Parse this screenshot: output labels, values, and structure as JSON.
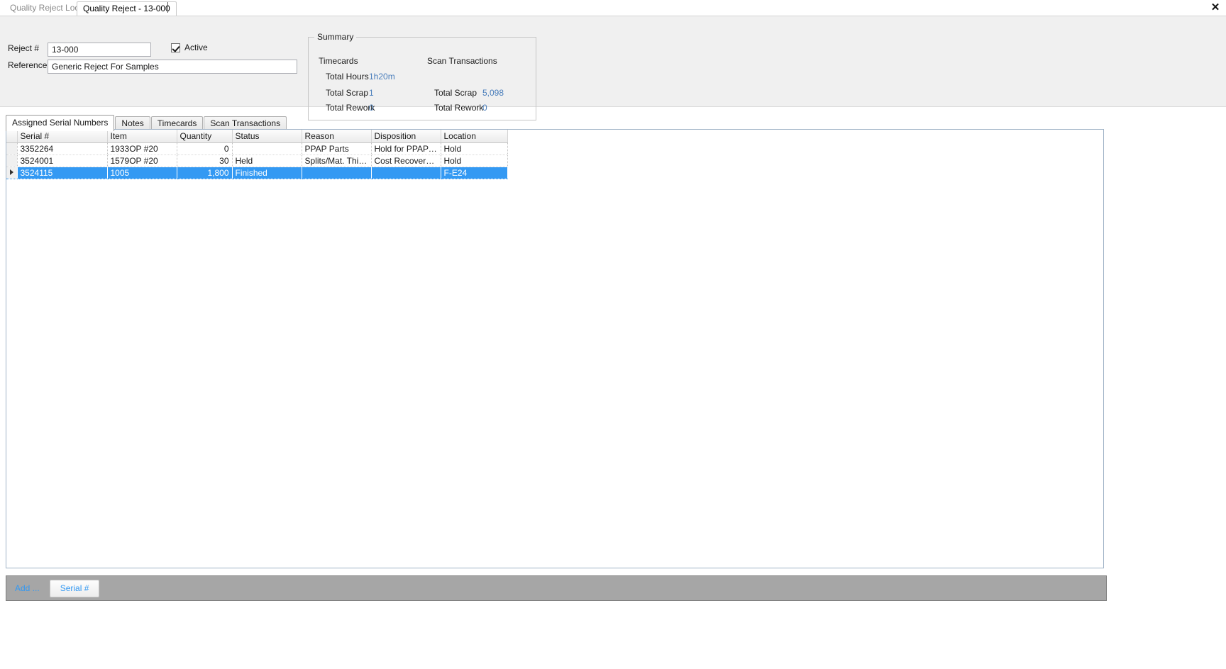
{
  "window": {
    "close_label": "✕"
  },
  "doc_tabs": [
    {
      "label": "Quality Reject Lookup",
      "active": false
    },
    {
      "label": "Quality Reject - 13-000",
      "active": true
    }
  ],
  "form": {
    "reject_label": "Reject #",
    "reject_value": "13-000",
    "reject_placeholder": "",
    "reference_label": "Reference",
    "reference_value": "Generic Reject For Samples",
    "reference_placeholder": "",
    "active_label": "Active",
    "active_checked": true
  },
  "summary": {
    "title": "Summary",
    "timecards_header": "Timecards",
    "scan_header": "Scan Transactions",
    "timecards": {
      "total_hours_label": "Total Hours",
      "total_hours_value": "1h20m",
      "total_scrap_label": "Total Scrap",
      "total_scrap_value": "1",
      "total_rework_label": "Total Rework",
      "total_rework_value": "0"
    },
    "scan": {
      "total_scrap_label": "Total Scrap",
      "total_scrap_value": "5,098",
      "total_rework_label": "Total Rework",
      "total_rework_value": "0"
    },
    "value_color": "#4a7ebb"
  },
  "inner_tabs": [
    {
      "label": "Assigned Serial Numbers",
      "selected": true
    },
    {
      "label": "Notes",
      "selected": false
    },
    {
      "label": "Timecards",
      "selected": false
    },
    {
      "label": "Scan Transactions",
      "selected": false
    }
  ],
  "grid": {
    "columns": [
      "Serial #",
      "Item",
      "Quantity",
      "Status",
      "Reason",
      "Disposition",
      "Location"
    ],
    "rows": [
      {
        "serial": "3352264",
        "item": "1933OP #20",
        "quantity": "0",
        "status": "",
        "reason": "PPAP Parts",
        "disposition": "Hold for PPAP A…",
        "location": "Hold",
        "selected": false,
        "current": false
      },
      {
        "serial": "3524001",
        "item": "1579OP #20",
        "quantity": "30",
        "status": "Held",
        "reason": "Splits/Mat. Thinn…",
        "disposition": "Cost Recovery -…",
        "location": "Hold",
        "selected": false,
        "current": false
      },
      {
        "serial": "3524115",
        "item": "1005",
        "quantity": "1,800",
        "status": "Finished",
        "reason": "",
        "disposition": "",
        "location": "F-E24",
        "selected": true,
        "current": true
      }
    ],
    "selection_color": "#3399f3"
  },
  "bottom_toolbar": {
    "add_label": "Add ...",
    "serial_button_label": "Serial #",
    "link_color": "#3399f3",
    "background_color": "#a6a6a6"
  }
}
